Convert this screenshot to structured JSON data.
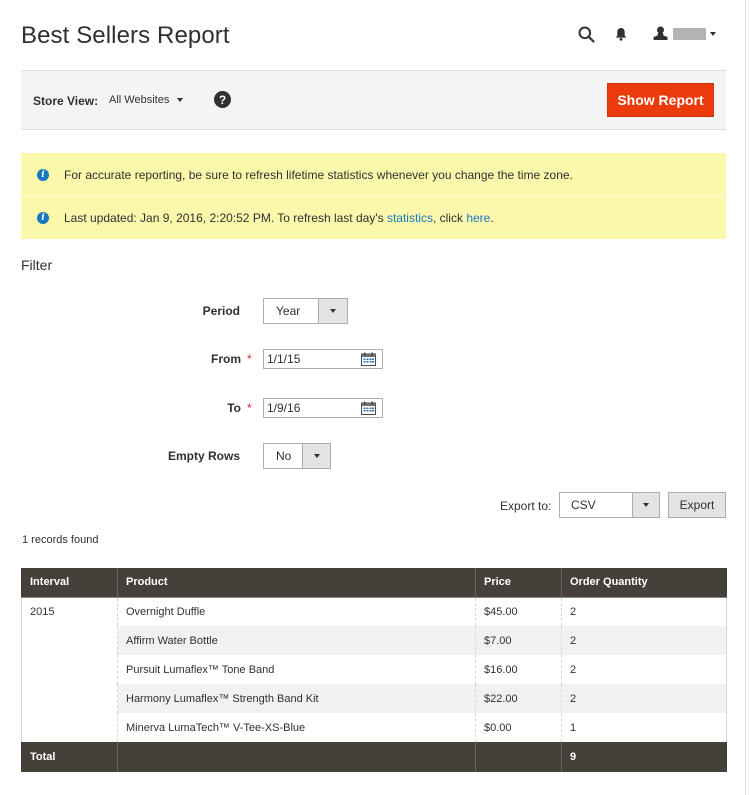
{
  "header": {
    "title": "Best Sellers Report",
    "icons": {
      "search": "search-icon",
      "notifications": "bell-icon",
      "user": "user-icon"
    },
    "user_name": ""
  },
  "store_bar": {
    "label": "Store View:",
    "selected": "All Websites",
    "help": "?",
    "show_report_label": "Show Report",
    "accent_color": "#eb5202"
  },
  "messages": [
    {
      "parts": [
        {
          "text": "For accurate reporting, be sure to refresh lifetime statistics whenever you change the time zone."
        }
      ]
    },
    {
      "parts": [
        {
          "text": "Last updated: Jan 9, 2016, 2:20:52 PM. To refresh last day's "
        },
        {
          "link": "statistics"
        },
        {
          "text": ", click "
        },
        {
          "link": "here"
        },
        {
          "text": "."
        }
      ]
    }
  ],
  "messages_flat": {
    "m1": "For accurate reporting, be sure to refresh lifetime statistics whenever you change the time zone.",
    "m2_pre": "Last updated: Jan 9, 2016, 2:20:52 PM. To refresh last day's ",
    "m2_link1": "statistics",
    "m2_mid": ", click ",
    "m2_link2": "here",
    "m2_post": "."
  },
  "filter": {
    "title": "Filter",
    "period": {
      "label": "Period",
      "value": "Year"
    },
    "from": {
      "label": "From",
      "required": "*",
      "value": "1/1/15"
    },
    "to": {
      "label": "To",
      "required": "*",
      "value": "1/9/16"
    },
    "empty_rows": {
      "label": "Empty Rows",
      "value": "No"
    }
  },
  "export": {
    "label": "Export to:",
    "format": "CSV",
    "button_label": "Export"
  },
  "records_found": "1 records found",
  "table": {
    "columns": [
      "Interval",
      "Product",
      "Price",
      "Order Quantity"
    ],
    "interval": "2015",
    "rows": [
      {
        "product": "Overnight Duffle",
        "price": "$45.00",
        "qty": "2"
      },
      {
        "product": "Affirm Water Bottle",
        "price": "$7.00",
        "qty": "2"
      },
      {
        "product": "Pursuit Lumaflex™ Tone Band",
        "price": "$16.00",
        "qty": "2"
      },
      {
        "product": "Harmony Lumaflex™ Strength Band Kit",
        "price": "$22.00",
        "qty": "2"
      },
      {
        "product": "Minerva LumaTech™ V-Tee-XS-Blue",
        "price": "$0.00",
        "qty": "1"
      }
    ],
    "total_label": "Total",
    "total_qty": "9"
  }
}
